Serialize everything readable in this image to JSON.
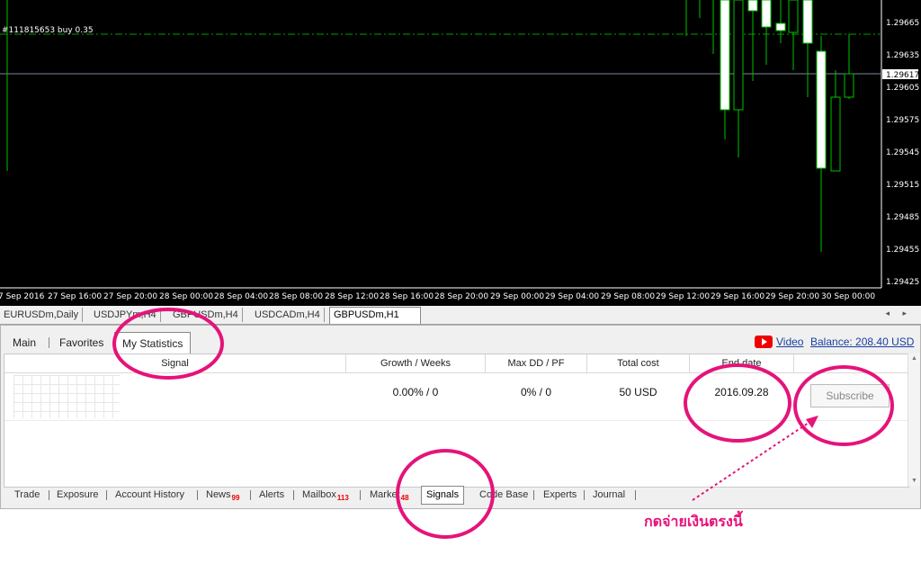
{
  "chart": {
    "order_line_label": "#111815653 buy 0.35",
    "price_axis": [
      "1.29665",
      "1.29635",
      "1.29605",
      "1.29575",
      "1.29545",
      "1.29515",
      "1.29485",
      "1.29455",
      "1.29425"
    ],
    "current_price": "1.29617",
    "time_axis": [
      "7 Sep 2016",
      "27 Sep 16:00",
      "27 Sep 20:00",
      "28 Sep 00:00",
      "28 Sep 04:00",
      "28 Sep 08:00",
      "28 Sep 12:00",
      "28 Sep 16:00",
      "28 Sep 20:00",
      "29 Sep 00:00",
      "29 Sep 04:00",
      "29 Sep 08:00",
      "29 Sep 12:00",
      "29 Sep 16:00",
      "29 Sep 20:00",
      "30 Sep 00:00"
    ],
    "colors": {
      "bull": "#ffffff",
      "bear": "#000000",
      "wick": "#00c000",
      "grid_dash": "#00a000"
    }
  },
  "chart_tabs": [
    "EURUSDm,Daily",
    "USDJPYm,H4",
    "GBPUSDm,H4",
    "USDCADm,H4",
    "GBPUSDm,H1"
  ],
  "panel": {
    "subtabs": [
      "Main",
      "Favorites",
      "My Statistics"
    ],
    "video_link": "Video",
    "balance_link": "Balance: 208.40 USD",
    "columns": [
      "Signal",
      "Growth / Weeks",
      "Max DD / PF",
      "Total cost",
      "End date"
    ],
    "row": {
      "growth": "0.00% / 0",
      "maxdd": "0% / 0",
      "cost": "50 USD",
      "end_date": "2016.09.28",
      "subscribe": "Subscribe"
    }
  },
  "bottom_tabs": {
    "trade": "Trade",
    "exposure": "Exposure",
    "history": "Account History",
    "news": "News",
    "news_count": "99",
    "alerts": "Alerts",
    "mailbox": "Mailbox",
    "mailbox_count": "113",
    "market": "Market",
    "market_count": "48",
    "signals": "Signals",
    "codebase": "Code Base",
    "experts": "Experts",
    "journal": "Journal"
  },
  "annotation": {
    "note": "กดจ่ายเงินตรงนี้",
    "color": "#e5137a"
  }
}
